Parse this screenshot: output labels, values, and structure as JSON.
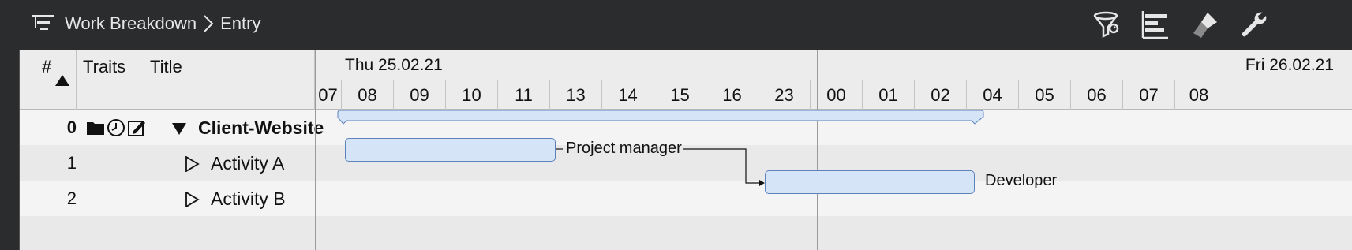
{
  "toolbar": {
    "view_name": "Work Breakdown",
    "sub_view": "Entry",
    "buttons": [
      {
        "name": "filter-button",
        "icon": "filter-icon"
      },
      {
        "name": "gantt-layout-button",
        "icon": "gantt-icon"
      },
      {
        "name": "style-button",
        "icon": "paintbrush-icon"
      },
      {
        "name": "settings-button",
        "icon": "wrench-icon"
      }
    ]
  },
  "table": {
    "columns": {
      "num": "#",
      "traits": "Traits",
      "title": "Title"
    },
    "sort_indicator": "ascending",
    "rows": [
      {
        "num": "0",
        "title": "Client-Website",
        "bold": true,
        "expanded": true,
        "traits": [
          "folder-icon",
          "clock-icon",
          "edit-icon"
        ]
      },
      {
        "num": "1",
        "title": "Activity A",
        "bold": false,
        "expanded": false,
        "traits": []
      },
      {
        "num": "2",
        "title": "Activity B",
        "bold": false,
        "expanded": false,
        "traits": []
      }
    ]
  },
  "timeline": {
    "days": [
      "Thu 25.02.21",
      "Fri 26.02.21"
    ],
    "hours": [
      "07",
      "08",
      "09",
      "10",
      "11",
      "13",
      "14",
      "15",
      "16",
      "23",
      "00",
      "01",
      "02",
      "04",
      "05",
      "06",
      "07",
      "08"
    ]
  },
  "gantt": {
    "bars": [
      {
        "task": "Activity A",
        "label": "Project manager"
      },
      {
        "task": "Activity B",
        "label": "Developer"
      }
    ]
  },
  "colors": {
    "toolbar_bg": "#2b2c2e",
    "bar_fill": "#d6e4f8",
    "bar_border": "#5e82bb"
  }
}
